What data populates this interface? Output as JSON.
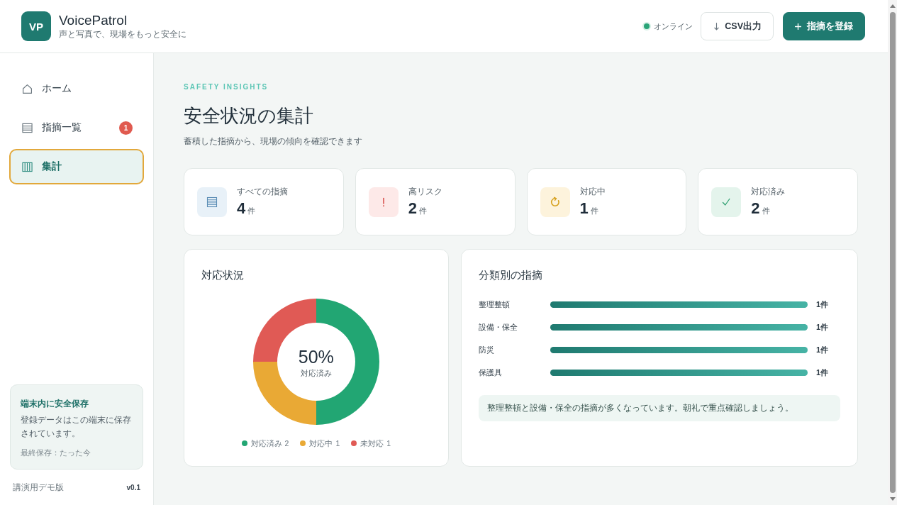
{
  "app": {
    "logo": "VP",
    "name": "VoicePatrol",
    "tagline": "声と写真で、現場をもっと安全に"
  },
  "header": {
    "status": {
      "label": "オンライン",
      "online": true
    },
    "buttons": [
      {
        "kind": "export",
        "label": "CSV出力"
      },
      {
        "kind": "add",
        "label": "指摘を登録"
      }
    ]
  },
  "sidebar": {
    "items": [
      {
        "kind": "home",
        "label": "ホーム",
        "selected": false
      },
      {
        "kind": "list",
        "label": "指摘一覧",
        "badge": "1",
        "selected": false
      },
      {
        "kind": "chart",
        "label": "集計",
        "selected": true
      }
    ],
    "storage_card": {
      "title": "端末内に安全保存",
      "text": "登録データはこの端末に保存されています。",
      "last_saved": "最終保存：たった今"
    },
    "footer": {
      "edition": "講演用デモ版",
      "version": "v0.1"
    }
  },
  "page": {
    "eyebrow": "SAFETY INSIGHTS",
    "title": "安全状況の集計",
    "subtitle": "蓄積した指摘から、現場の傾向を確認できます"
  },
  "stats": [
    {
      "kind": "all",
      "label": "すべての指摘",
      "value": "4",
      "unit": "件"
    },
    {
      "kind": "risk",
      "label": "高リスク",
      "value": "2",
      "unit": "件"
    },
    {
      "kind": "progress",
      "label": "対応中",
      "value": "1",
      "unit": "件"
    },
    {
      "kind": "done",
      "label": "対応済み",
      "value": "2",
      "unit": "件"
    }
  ],
  "status_chart": {
    "title": "対応状況",
    "center_value": "50%",
    "center_label": "対応済み",
    "chart_data": {
      "type": "donut",
      "categories": [
        "対応済み",
        "対応中",
        "未対応"
      ],
      "values": [
        50,
        25,
        25
      ]
    },
    "legend": [
      {
        "count": "2",
        "color": "#22a673"
      },
      {
        "count": "1",
        "color": "#e9a935"
      },
      {
        "count": "1",
        "color": "#e05a55"
      }
    ]
  },
  "category_chart": {
    "title": "分類別の指摘",
    "rows": [
      {
        "label": "整理整頓",
        "level": 1,
        "count": "1件"
      },
      {
        "label": "設備・保全",
        "level": 1,
        "count": "1件"
      },
      {
        "label": "防災",
        "level": 1,
        "count": "1件"
      },
      {
        "label": "保護具",
        "level": 1,
        "count": "1件"
      }
    ],
    "note": "整理整頓と設備・保全の指摘が多くなっています。朝礼で重点確認しましょう。"
  }
}
